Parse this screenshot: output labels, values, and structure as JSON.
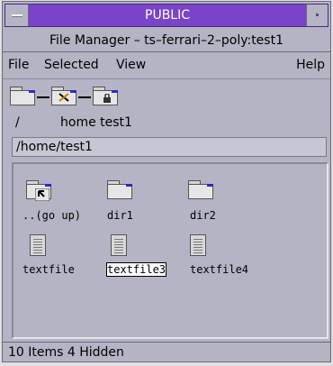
{
  "window": {
    "workspace_title": "PUBLIC",
    "subtitle": "File Manager – ts–ferrari–2–poly:test1"
  },
  "menubar": {
    "file": "File",
    "selected": "Selected",
    "view": "View",
    "help": "Help"
  },
  "breadcrumb": {
    "root": "/",
    "path": "home test1"
  },
  "path_field": {
    "value": "/home/test1"
  },
  "items": [
    {
      "label": "..(go up)",
      "icon": "go-up-folder-icon"
    },
    {
      "label": "dir1",
      "icon": "folder-icon"
    },
    {
      "label": "dir2",
      "icon": "folder-icon"
    },
    {
      "label": "textfile",
      "icon": "text-file-icon"
    },
    {
      "label": "textfile3",
      "icon": "text-file-icon",
      "selected": true
    },
    {
      "label": "textfile4",
      "icon": "text-file-icon"
    }
  ],
  "status": {
    "text": "10 Items 4 Hidden"
  },
  "colors": {
    "titlebar": "#7a44c8",
    "background": "#b4b4c4",
    "folder_accent": "#2a2ac8"
  }
}
